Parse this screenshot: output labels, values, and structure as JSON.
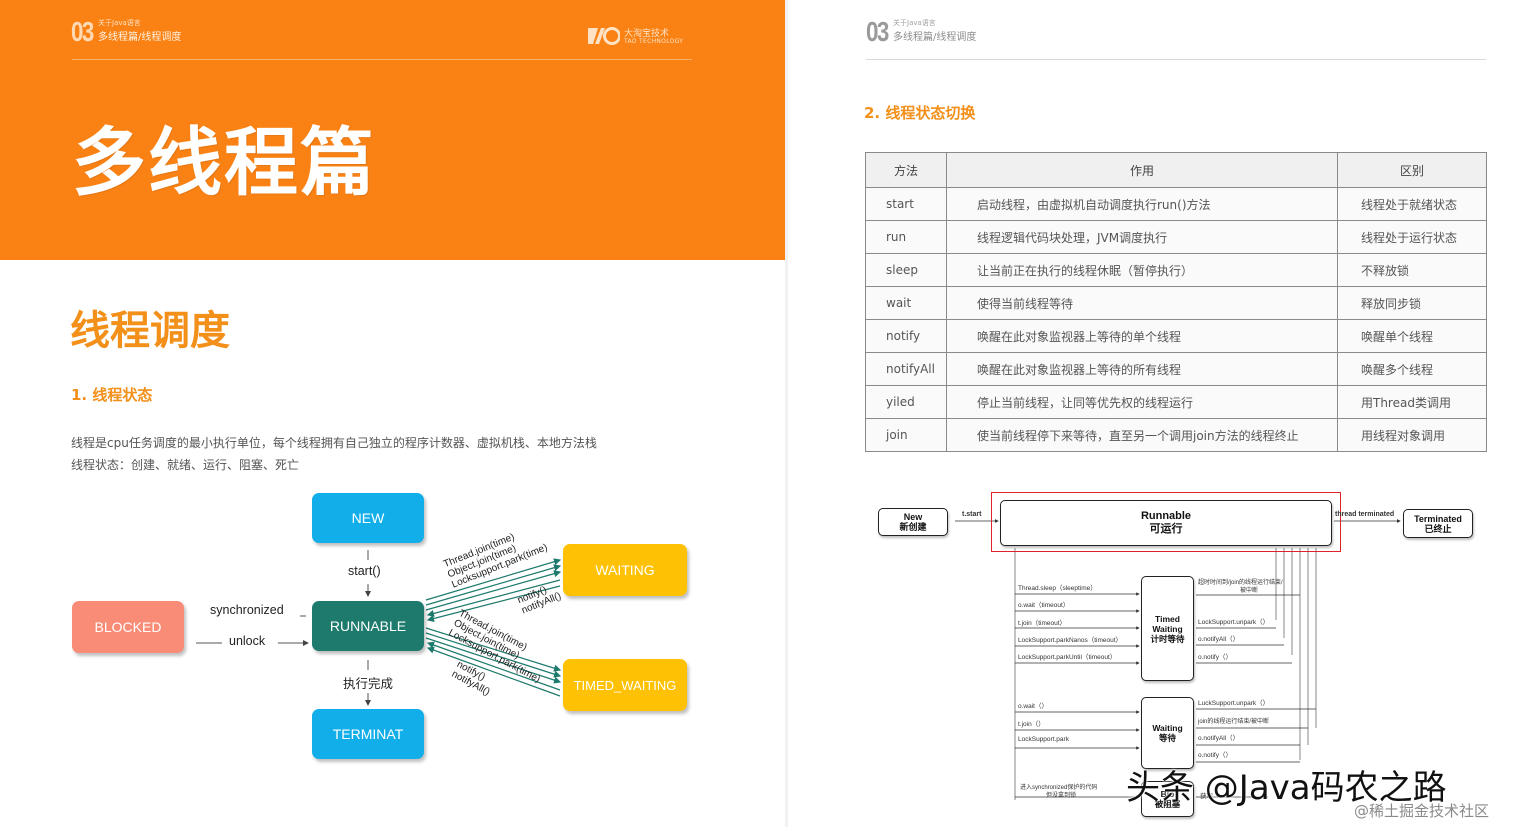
{
  "left_page": {
    "header": {
      "number": "03",
      "small": "关于Java语言",
      "title": "多线程篇/线程调度",
      "logo_text": "大淘宝技术",
      "logo_sub": "TAO TECHNOLOGY"
    },
    "hero_title": "多线程篇",
    "section_title": "线程调度",
    "subsection": "1.  线程状态",
    "paragraphs": [
      "线程是cpu任务调度的最小执行单位，每个线程拥有自己独立的程序计数器、虚拟机栈、本地方法栈",
      "线程状态：创建、就绪、运行、阻塞、死亡"
    ],
    "diagram": {
      "nodes": {
        "new": "NEW",
        "runnable": "RUNNABLE",
        "blocked": "BLOCKED",
        "waiting": "WAITING",
        "timed_waiting": "TIMED_WAITING",
        "terminat": "TERMINAT"
      },
      "labels": {
        "start": "start()",
        "synchronized": "synchronized",
        "unlock": "unlock",
        "done": "执行完成",
        "to_waiting": [
          "Thread.join(time)",
          "Object.join(time)",
          "Locksupport.park(time)"
        ],
        "from_waiting": [
          "notify()",
          "notifyAll()"
        ],
        "to_timed": [
          "Thread.join(time)",
          "Object.join(time)",
          "Locksupport.park(time)"
        ],
        "from_timed": [
          "notify()",
          "notifyAll()"
        ]
      },
      "colors": {
        "blue": "#12aeea",
        "teal": "#1d7a6c",
        "yellow": "#ffc104",
        "salmon": "#f98c76",
        "orange": "#fa8214",
        "section": "#f39019"
      }
    }
  },
  "right_page": {
    "header": {
      "number": "03",
      "small": "关于Java语言",
      "title": "多线程篇/线程调度"
    },
    "section_title": "2.  线程状态切换",
    "table": {
      "headers": [
        "方法",
        "作用",
        "区别"
      ],
      "rows": [
        [
          "start",
          "启动线程，由虚拟机自动调度执行run()方法",
          "线程处于就绪状态"
        ],
        [
          "run",
          "线程逻辑代码块处理，JVM调度执行",
          "线程处于运行状态"
        ],
        [
          "sleep",
          "让当前正在执行的线程休眠（暂停执行）",
          "不释放锁"
        ],
        [
          "wait",
          "使得当前线程等待",
          "释放同步锁"
        ],
        [
          "notify",
          "唤醒在此对象监视器上等待的单个线程",
          "唤醒单个线程"
        ],
        [
          "notifyAll",
          "唤醒在此对象监视器上等待的所有线程",
          "唤醒多个线程"
        ],
        [
          "yiled",
          "停止当前线程，让同等优先权的线程运行",
          "用Thread类调用"
        ],
        [
          "join",
          "使当前线程停下来等待，直至另一个调用join方法的线程终止",
          "用线程对象调用"
        ]
      ]
    },
    "diagram": {
      "new": [
        "New",
        "新创建"
      ],
      "tstart": "t.start",
      "runnable": [
        "Runnable",
        "可运行"
      ],
      "thread_terminated": "thread terminated",
      "terminated": [
        "Terminated",
        "已终止"
      ],
      "timed": [
        "Timed",
        "Waiting",
        "计时等待"
      ],
      "waiting": [
        "Waiting",
        "等待"
      ],
      "timed_in": [
        "Thread.sleep（sleeptime）",
        "o.wait（timeout）",
        "t.join（timeout）",
        "LockSupport.parkNanos（timeout）",
        "LockSupport.parkUntil（timeout）"
      ],
      "timed_out": [
        "超时时间到/join的线程运行结束/",
        "被中断",
        "LockSupport.unpark（）",
        "o.notifyAll（）",
        "o.notify（）"
      ],
      "wait_in": [
        "o.wait（）",
        "t.join（）",
        "LockSupport.park"
      ],
      "wait_out": [
        "LuckSupport.unpark（）",
        "join的线程运行结束/被中断",
        "o.notifyAll（）",
        "o.notify（）"
      ],
      "blocked_in": [
        "进入synchronized保护的代码",
        "但没拿到锁"
      ],
      "blocked": [
        "Blo",
        "被阻塞"
      ],
      "blocked_out": "获取"
    },
    "watermark": {
      "main": "头条 @Java码农之路",
      "sub": "@稀土掘金技术社区"
    }
  }
}
